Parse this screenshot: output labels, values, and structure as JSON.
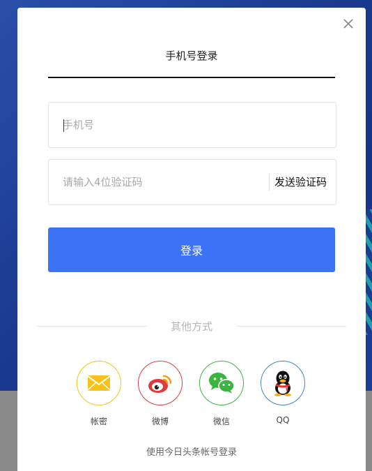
{
  "tab": {
    "title": "手机号登录"
  },
  "phone": {
    "placeholder": "手机号",
    "value": ""
  },
  "code": {
    "placeholder": "请输入4位验证码",
    "value": "",
    "send_label": "发送验证码"
  },
  "login": {
    "label": "登录"
  },
  "others": {
    "label": "其他方式",
    "items": [
      {
        "label": "帐密",
        "icon": "envelope-icon",
        "color": "#f5c518"
      },
      {
        "label": "微博",
        "icon": "weibo-icon",
        "color": "#e0393e"
      },
      {
        "label": "微信",
        "icon": "wechat-icon",
        "color": "#3bb53f"
      },
      {
        "label": "QQ",
        "icon": "qq-icon",
        "color": "#3a86c8"
      }
    ]
  },
  "footer": {
    "link": "使用今日头条帐号登录"
  },
  "colors": {
    "primary": "#3b72f6",
    "text": "#222222"
  }
}
